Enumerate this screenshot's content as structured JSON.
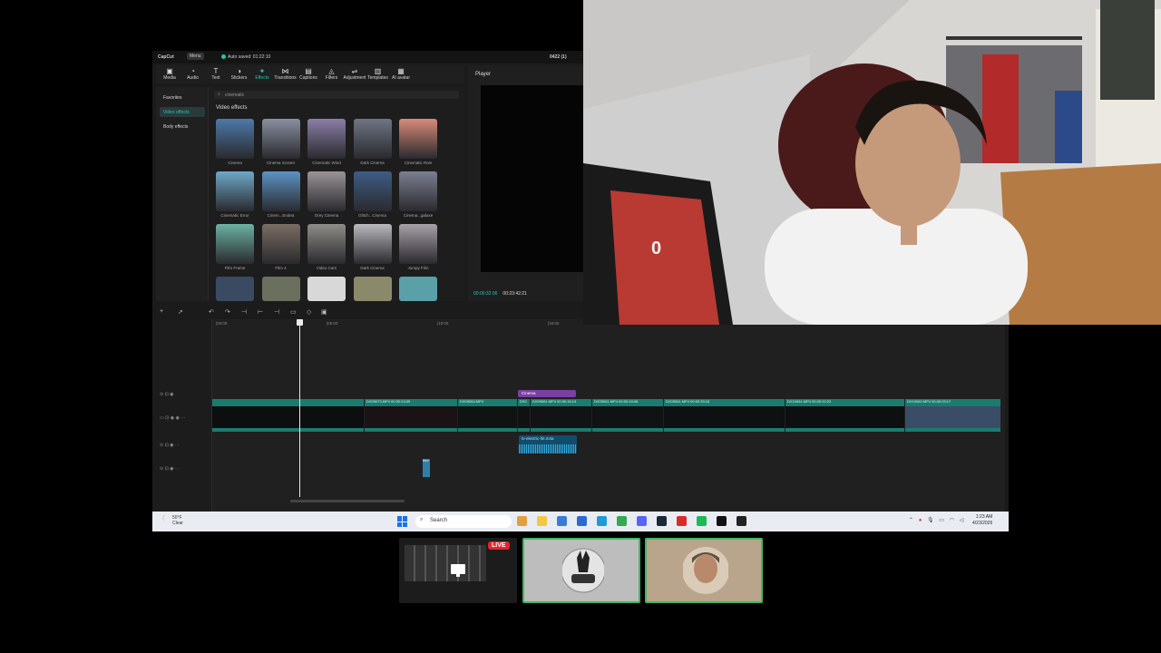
{
  "app": {
    "name": "CapCut",
    "menu_label": "Menu",
    "autosave": "Auto saved: 01:22:10",
    "project": "0422 (1)"
  },
  "toolbar": {
    "tools": [
      {
        "label": "Media",
        "icon": "media-icon",
        "glyph": "▣",
        "active": false
      },
      {
        "label": "Audio",
        "icon": "audio-icon",
        "glyph": "◔",
        "active": false
      },
      {
        "label": "Text",
        "icon": "text-icon",
        "glyph": "T",
        "active": false
      },
      {
        "label": "Stickers",
        "icon": "sticker-icon",
        "glyph": "◑",
        "active": false
      },
      {
        "label": "Effects",
        "icon": "effects-icon",
        "glyph": "✦",
        "active": true
      },
      {
        "label": "Transitions",
        "icon": "transitions-icon",
        "glyph": "⋈",
        "active": false
      },
      {
        "label": "Captions",
        "icon": "captions-icon",
        "glyph": "▤",
        "active": false
      },
      {
        "label": "Filters",
        "icon": "filters-icon",
        "glyph": "◬",
        "active": false
      },
      {
        "label": "Adjustment",
        "icon": "adjustment-icon",
        "glyph": "⇌",
        "active": false
      },
      {
        "label": "Templates",
        "icon": "templates-icon",
        "glyph": "▥",
        "active": false
      },
      {
        "label": "AI avatar",
        "icon": "ai-avatar-icon",
        "glyph": "▦",
        "active": false
      }
    ]
  },
  "left_nav": {
    "items": [
      {
        "label": "Favorites",
        "active": false
      },
      {
        "label": "Video effects",
        "active": true
      },
      {
        "label": "Body effects",
        "active": false
      }
    ]
  },
  "effects_panel": {
    "search_value": "cinematic",
    "section_title": "Video effects",
    "items": [
      {
        "label": "Cinema",
        "color": "#4d79a8"
      },
      {
        "label": "Cinema Screen",
        "color": "#8a8fa0"
      },
      {
        "label": "Cinematic Wind",
        "color": "#8c7fa8"
      },
      {
        "label": "Dark Cinema",
        "color": "#6f7584"
      },
      {
        "label": "Cinematic Rain",
        "color": "#d98a78"
      },
      {
        "label": "Cinematic Error",
        "color": "#6ea8c9"
      },
      {
        "label": "Cinem...Endea",
        "color": "#5c93c4"
      },
      {
        "label": "Grey Cinema",
        "color": "#9a9496"
      },
      {
        "label": "Glitch...Cinema",
        "color": "#3e5c86"
      },
      {
        "label": "Cinema...galaxe",
        "color": "#7c7f91"
      },
      {
        "label": "Film Frame",
        "color": "#6cb2a4"
      },
      {
        "label": "Film 4",
        "color": "#7a6d63"
      },
      {
        "label": "Video Cam",
        "color": "#8f8d88"
      },
      {
        "label": "Dark Cinema",
        "color": "#b8b8bd"
      },
      {
        "label": "Jumpy Film",
        "color": "#a8a0a8"
      }
    ]
  },
  "player": {
    "title": "Player",
    "current_time": "00:00:32:06",
    "total_time": "00:23:42:21"
  },
  "timeline": {
    "ruler": [
      "|00:00",
      "|05:00",
      "|10:00",
      "|15:00"
    ],
    "clips": [
      {
        "label": "",
        "color": "#0d0e10"
      },
      {
        "label": "DX09073.MP4  00:00:24:09",
        "color": "#1a1214"
      },
      {
        "label": "DX09064.MP4",
        "color": "#0f1412"
      },
      {
        "label": "DX0",
        "color": "#111"
      },
      {
        "label": "DX09061.MP4  00:00:16:13",
        "color": "#111315"
      },
      {
        "label": "DX09061.MP4  00:00:19:06",
        "color": "#101214"
      },
      {
        "label": "DX09061.MP4  00:00:33:16",
        "color": "#0e1011"
      },
      {
        "label": "DX10061.MP4  00:00:22:22",
        "color": "#0e0f10"
      },
      {
        "label": "DX10062.MP4  00:00:23:17",
        "color": "#3a4c66"
      }
    ],
    "effect_clip": "Cinema",
    "audio_clip": "tv-electric-hit.m4a",
    "mini_clip": "Mov"
  },
  "taskbar": {
    "weather_temp": "50°F",
    "weather_desc": "Clear",
    "search_placeholder": "Search",
    "time": "1:23 AM",
    "date": "4/23/2026"
  },
  "stream": {
    "live_label": "LIVE"
  }
}
